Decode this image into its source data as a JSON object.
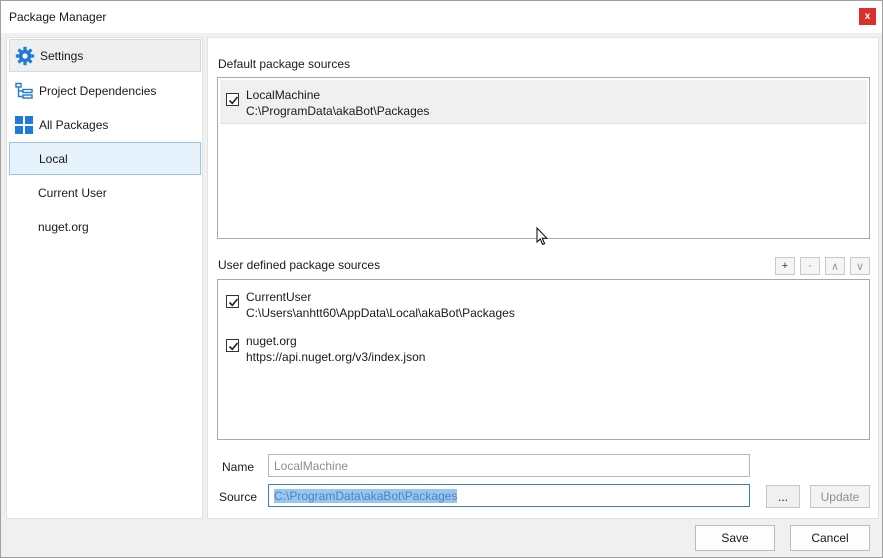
{
  "window": {
    "title": "Package Manager",
    "close_label": "x"
  },
  "sidebar": {
    "items": [
      {
        "label": "Settings",
        "icon": "gear-icon"
      },
      {
        "label": "Project Dependencies",
        "icon": "tree-icon"
      },
      {
        "label": "All Packages",
        "icon": "grid-icon"
      },
      {
        "label": "Local"
      },
      {
        "label": "Current User"
      },
      {
        "label": "nuget.org"
      }
    ]
  },
  "default_sources": {
    "label": "Default package sources",
    "items": [
      {
        "name": "LocalMachine",
        "path": "C:\\ProgramData\\akaBot\\Packages",
        "checked": true
      }
    ]
  },
  "user_sources": {
    "label": "User defined package sources",
    "buttons": {
      "add": "+",
      "remove": "-",
      "up": "∧",
      "down": "∨"
    },
    "items": [
      {
        "name": "CurrentUser",
        "path": "C:\\Users\\anhtt60\\AppData\\Local\\akaBot\\Packages",
        "checked": true
      },
      {
        "name": "nuget.org",
        "path": "https://api.nuget.org/v3/index.json",
        "checked": true
      }
    ]
  },
  "form": {
    "name_label": "Name",
    "name_value": "LocalMachine",
    "source_label": "Source",
    "source_value": "C:\\ProgramData\\akaBot\\Packages",
    "browse_label": "...",
    "update_label": "Update"
  },
  "footer": {
    "save_label": "Save",
    "cancel_label": "Cancel"
  },
  "colors": {
    "accent": "#1e7bd6",
    "close": "#d9302c",
    "selection": "#e5f1fb"
  }
}
